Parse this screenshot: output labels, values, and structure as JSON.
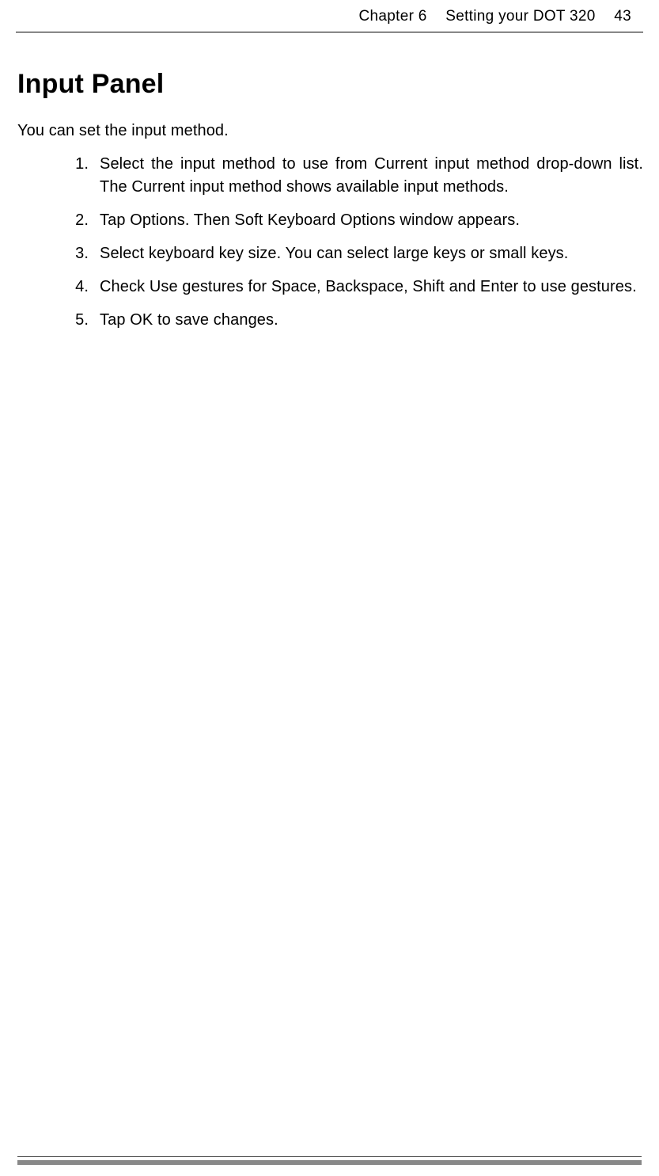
{
  "header": {
    "chapter": "Chapter 6",
    "title": "Setting your DOT 320",
    "page": "43"
  },
  "heading": "Input Panel",
  "intro": "You can set the input method.",
  "steps": [
    {
      "num": "1.",
      "text": "Select the input method to use from Current input method drop-down list. The Current input method shows available input methods."
    },
    {
      "num": "2.",
      "text": "Tap Options. Then Soft Keyboard Options window appears."
    },
    {
      "num": "3.",
      "text": "Select keyboard key size. You can select large keys or small keys."
    },
    {
      "num": "4.",
      "text": "Check Use gestures for Space, Backspace, Shift and Enter to use gestures."
    },
    {
      "num": "5.",
      "text": "Tap OK to save changes."
    }
  ]
}
